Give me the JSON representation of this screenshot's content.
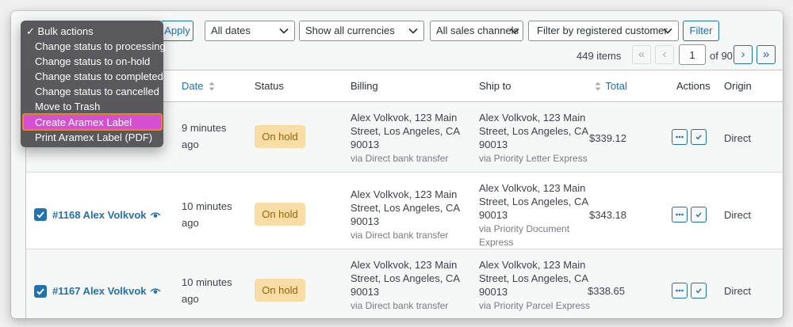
{
  "toolbar": {
    "apply_label": "Apply",
    "dates_filter": "All dates",
    "currency_filter": "Show all currencies",
    "channel_filter": "All sales channels",
    "customer_filter": "Filter by registered customer",
    "filter_label": "Filter"
  },
  "pagination": {
    "items_count": "449 items",
    "first": "«",
    "prev": "‹",
    "current_page": "1",
    "of_pages": "of 90",
    "next": "›",
    "last": "»"
  },
  "bulk_menu": {
    "selected": "✓ Bulk actions",
    "items": [
      "Change status to processing",
      "Change status to on-hold",
      "Change status to completed",
      "Change status to cancelled",
      "Move to Trash",
      "Create Aramex Label",
      "Print Aramex Label (PDF)"
    ],
    "highlighted_index": 5
  },
  "table": {
    "headers": {
      "date": "Date",
      "status": "Status",
      "billing": "Billing",
      "ship_to": "Ship to",
      "total": "Total",
      "actions": "Actions",
      "origin": "Origin"
    },
    "rows": [
      {
        "order": "",
        "date_line1": "9 minutes",
        "date_line2": "ago",
        "status": "On hold",
        "billing_line1": "Alex Volkvok, 123 Main",
        "billing_line2": "Street, Los Angeles, CA",
        "billing_line3": "90013",
        "billing_via": "via Direct bank transfer",
        "ship_line1": "Alex Volkvok, 123 Main",
        "ship_line2": "Street, Los Angeles, CA",
        "ship_line3": "90013",
        "ship_via1": "via Priority Letter Express",
        "ship_via2": "",
        "total": "$339.12",
        "origin": "Direct"
      },
      {
        "order": "#1168 Alex Volkvok",
        "date_line1": "10 minutes",
        "date_line2": "ago",
        "status": "On hold",
        "billing_line1": "Alex Volkvok, 123 Main",
        "billing_line2": "Street, Los Angeles, CA",
        "billing_line3": "90013",
        "billing_via": "via Direct bank transfer",
        "ship_line1": "Alex Volkvok, 123 Main",
        "ship_line2": "Street, Los Angeles, CA",
        "ship_line3": "90013",
        "ship_via1": "via Priority Document",
        "ship_via2": "Express",
        "total": "$343.18",
        "origin": "Direct"
      },
      {
        "order": "#1167 Alex Volkvok",
        "date_line1": "10 minutes",
        "date_line2": "ago",
        "status": "On hold",
        "billing_line1": "Alex Volkvok, 123 Main",
        "billing_line2": "Street, Los Angeles, CA",
        "billing_line3": "90013",
        "billing_via": "via Direct bank transfer",
        "ship_line1": "Alex Volkvok, 123 Main",
        "ship_line2": "Street, Los Angeles, CA",
        "ship_line3": "90013",
        "ship_via1": "via Priority Parcel Express",
        "ship_via2": "",
        "total": "$338.65",
        "origin": "Direct"
      }
    ]
  },
  "colors": {
    "accent": "#2271b1",
    "status_on_hold_bg": "#f8dda7",
    "status_on_hold_text": "#94660c",
    "menu_highlight": "#d44fd1",
    "menu_highlight_border": "#e08a1e"
  },
  "icons": {
    "sort": "sort-arrows-icon",
    "preview": "eye-icon",
    "more": "ellipsis-icon",
    "complete": "checkmark-icon",
    "dropdown": "chevron-down-icon"
  }
}
